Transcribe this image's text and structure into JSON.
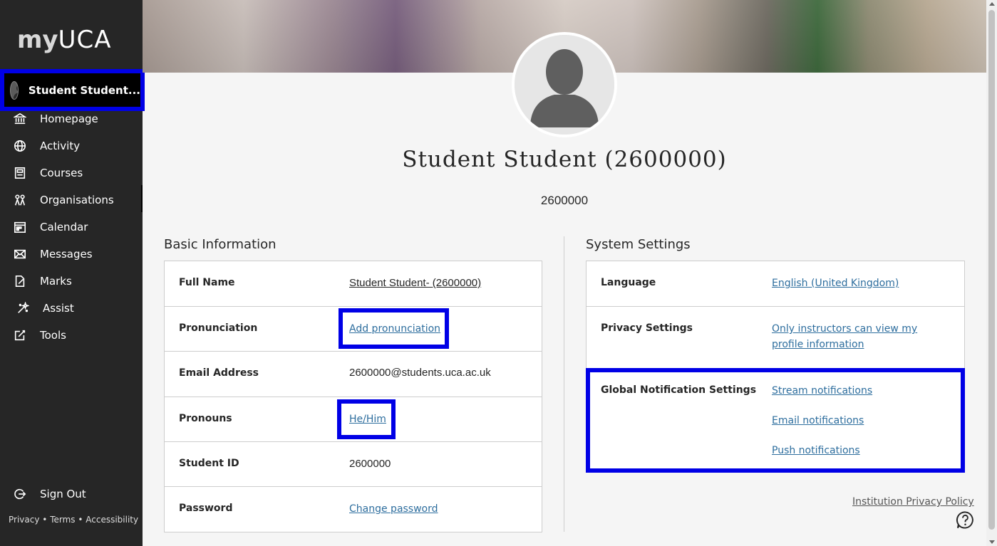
{
  "sidebar": {
    "logo": {
      "prefix": "my",
      "suffix": "UCA"
    },
    "user_name": "Student Student...",
    "items": [
      {
        "label": "Homepage",
        "icon": "institution-icon"
      },
      {
        "label": "Activity",
        "icon": "globe-icon"
      },
      {
        "label": "Courses",
        "icon": "book-icon"
      },
      {
        "label": "Organisations",
        "icon": "organisations-icon"
      },
      {
        "label": "Calendar",
        "icon": "calendar-icon"
      },
      {
        "label": "Messages",
        "icon": "envelope-icon"
      },
      {
        "label": "Marks",
        "icon": "marks-icon"
      },
      {
        "label": "Assist",
        "icon": "assist-icon"
      },
      {
        "label": "Tools",
        "icon": "tools-icon"
      }
    ],
    "sign_out": "Sign Out",
    "footer": {
      "privacy": "Privacy",
      "terms": "Terms",
      "accessibility": "Accessibility",
      "separator": "•"
    }
  },
  "profile": {
    "name": "Student Student (2600000)",
    "id": "2600000"
  },
  "basic_info": {
    "title": "Basic Information",
    "rows": [
      {
        "label": "Full Name",
        "value": "Student Student- (2600000)"
      },
      {
        "label": "Pronunciation",
        "value": "Add pronunciation"
      },
      {
        "label": "Email Address",
        "value": "2600000@students.uca.ac.uk"
      },
      {
        "label": "Pronouns",
        "value": "He/Him"
      },
      {
        "label": "Student ID",
        "value": "2600000"
      },
      {
        "label": "Password",
        "value": "Change password"
      }
    ]
  },
  "system_settings": {
    "title": "System Settings",
    "language": {
      "label": "Language",
      "value": "English (United Kingdom)"
    },
    "privacy": {
      "label": "Privacy Settings",
      "value_line1": "Only instructors can view my",
      "value_line2": "profile information"
    },
    "notifications": {
      "label": "Global Notification Settings",
      "stream": "Stream notifications",
      "email": "Email notifications",
      "push": "Push notifications"
    }
  },
  "footer": {
    "institution_privacy": "Institution Privacy Policy"
  },
  "colors": {
    "sidebar_bg": "#262626",
    "highlight": "#0000e6",
    "link": "#2e6e9e"
  }
}
